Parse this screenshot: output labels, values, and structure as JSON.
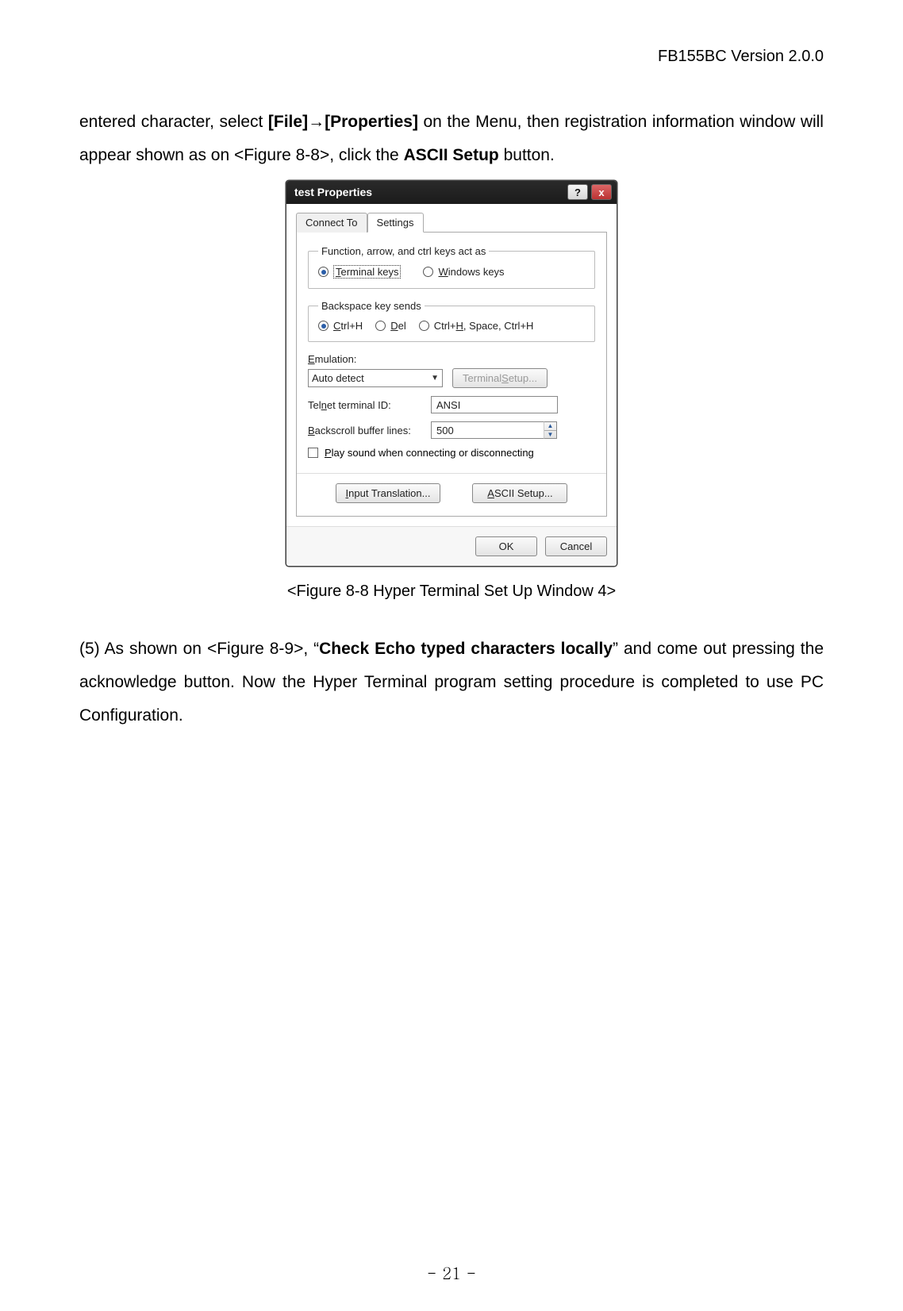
{
  "header": {
    "version": "FB155BC Version 2.0.0"
  },
  "para1": {
    "pre": "entered character, select ",
    "menu1": "[File]",
    "arrow": "→",
    "menu2": "[Properties]",
    "mid": " on the Menu, then registration information window will appear shown as on <Figure 8-8>, click the ",
    "btn": "ASCII Setup",
    "post": " button."
  },
  "dlg": {
    "title": "test Properties",
    "help": "?",
    "close": "x",
    "tabs": {
      "connect": "Connect To",
      "settings": "Settings"
    },
    "group1": {
      "legend": "Function, arrow, and ctrl keys act as",
      "opt1_u": "T",
      "opt1_rest": "erminal keys",
      "opt2_u": "W",
      "opt2_rest": "indows keys"
    },
    "group2": {
      "legend": "Backspace key sends",
      "opt1_u": "C",
      "opt1_rest": "trl+H",
      "opt2_u": "D",
      "opt2_rest": "el",
      "opt3_pre": "Ctrl+",
      "opt3_u": "H",
      "opt3_rest": ", Space, Ctrl+H"
    },
    "emu_label_u": "E",
    "emu_label_rest": "mulation:",
    "emu_value": "Auto detect",
    "term_setup_pre": "Terminal ",
    "term_setup_u": "S",
    "term_setup_rest": "etup...",
    "telnet_pre": "Tel",
    "telnet_u": "n",
    "telnet_rest": "et terminal ID:",
    "telnet_value": "ANSI",
    "back_u": "B",
    "back_rest": "ackscroll buffer lines:",
    "back_value": "500",
    "play_u": "P",
    "play_rest": "lay sound when connecting or disconnecting",
    "input_u": "I",
    "input_rest": "nput Translation...",
    "ascii_u": "A",
    "ascii_rest": "SCII Setup...",
    "ok": "OK",
    "cancel": "Cancel"
  },
  "caption": "<Figure 8-8 Hyper Terminal Set Up Window 4>",
  "para2": {
    "pre": "(5) As shown on <Figure 8-9>, “",
    "bold": "Check Echo typed characters locally",
    "post": "” and come out pressing the acknowledge button. Now the Hyper Terminal program setting procedure is completed to use PC Configuration."
  },
  "page_num": "- 21 -"
}
